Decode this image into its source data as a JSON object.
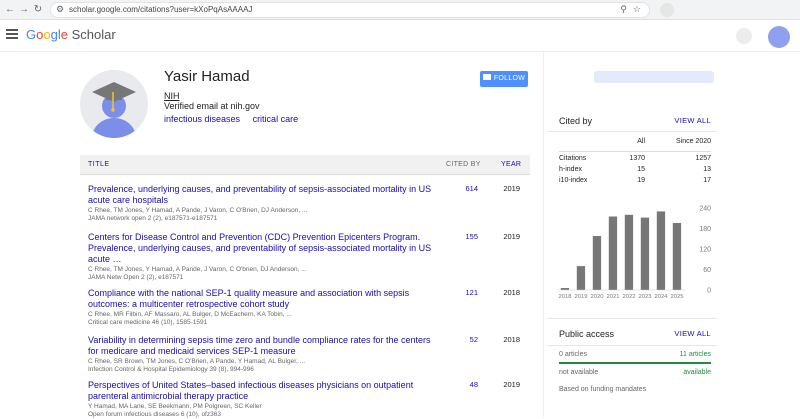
{
  "browser": {
    "url": "scholar.google.com/citations?user=kXoPqAsAAAAJ"
  },
  "header": {
    "logo_google": [
      "G",
      "o",
      "o",
      "g",
      "l",
      "e"
    ],
    "logo_scholar": "Scholar"
  },
  "profile": {
    "name": "Yasir Hamad",
    "affiliation": "NIH",
    "email": "Verified email at nih.gov",
    "interests": [
      "infectious diseases",
      "critical care"
    ],
    "follow_label": "FOLLOW"
  },
  "table": {
    "col_title": "TITLE",
    "col_cited": "CITED BY",
    "col_year": "YEAR"
  },
  "articles": [
    {
      "title": "Prevalence, underlying causes, and preventability of sepsis-associated mortality in US acute care hospitals",
      "authors": "C Rhee, TM Jones, Y Hamad, A Pande, J Varon, C O'Brien, DJ Anderson, ...",
      "venue": "JAMA network open 2 (2), e187571-e187571",
      "cited": "614",
      "year": "2019"
    },
    {
      "title": "Centers for Disease Control and Prevention (CDC) Prevention Epicenters Program. Prevalence, underlying causes, and preventability of sepsis-associated mortality in US acute …",
      "authors": "C Rhee, TM Jones, Y Hamad, A Pande, J Varon, C O'brien, DJ Anderson, ...",
      "venue": "JAMA Netw Open 2 (2), e187571",
      "cited": "155",
      "year": "2019"
    },
    {
      "title": "Compliance with the national SEP-1 quality measure and association with sepsis outcomes: a multicenter retrospective cohort study",
      "authors": "C Rhee, MR Filbin, AF Massaro, AL Bulger, D McEachern, KA Tobin, ...",
      "venue": "Critical care medicine 46 (10), 1585-1591",
      "cited": "121",
      "year": "2018"
    },
    {
      "title": "Variability in determining sepsis time zero and bundle compliance rates for the centers for medicare and medicaid services SEP-1 measure",
      "authors": "C Rhee, SR Brown, TM Jones, C O'Brien, A Pande, Y Hamad, AL Bulger, ...",
      "venue": "Infection Control & Hospital Epidemiology 39 (8), 994-996",
      "cited": "52",
      "year": "2018"
    },
    {
      "title": "Perspectives of United States–based infectious diseases physicians on outpatient parenteral antimicrobial therapy practice",
      "authors": "Y Hamad, MA Lane, SE Beekmann, PM Polgreen, SC Keller",
      "venue": "Open forum infectious diseases 6 (10), ofz363",
      "cited": "48",
      "year": "2019"
    }
  ],
  "cited_by": {
    "title": "Cited by",
    "view_all": "VIEW ALL",
    "col_all": "All",
    "col_since": "Since 2020",
    "rows": [
      {
        "label": "Citations",
        "all": "1370",
        "since": "1257"
      },
      {
        "label": "h-index",
        "all": "15",
        "since": "13"
      },
      {
        "label": "i10-index",
        "all": "19",
        "since": "17"
      }
    ]
  },
  "chart_data": {
    "type": "bar",
    "categories": [
      "2018",
      "2019",
      "2020",
      "2021",
      "2022",
      "2023",
      "2024",
      "2025"
    ],
    "values": [
      6,
      70,
      158,
      215,
      220,
      212,
      230,
      196
    ],
    "y_ticks": [
      0,
      60,
      120,
      180,
      240
    ],
    "ylim": [
      0,
      240
    ],
    "bar_color": "#777777"
  },
  "public_access": {
    "title": "Public access",
    "view_all": "VIEW ALL",
    "left1": "0 articles",
    "right1": "11 articles",
    "left2": "not available",
    "right2": "available",
    "note": "Based on funding mandates"
  }
}
